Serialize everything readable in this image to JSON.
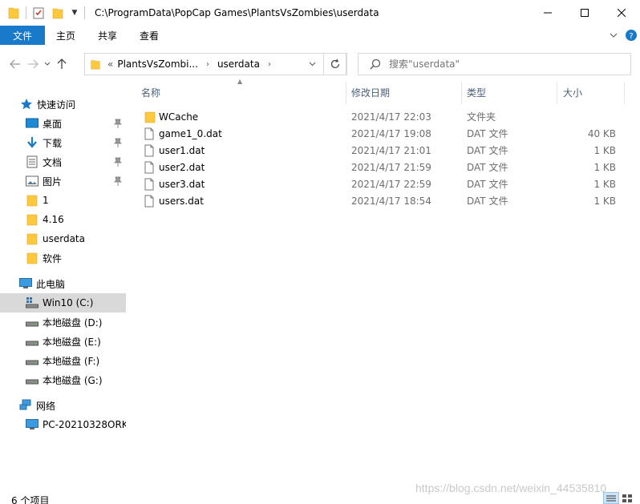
{
  "window": {
    "title_path": "C:\\ProgramData\\PopCap Games\\PlantsVsZombies\\userdata"
  },
  "ribbon": {
    "tabs": [
      "文件",
      "主页",
      "共享",
      "查看"
    ]
  },
  "address": {
    "overflow": "«",
    "crumbs": [
      "PlantsVsZombi...",
      "userdata"
    ]
  },
  "search": {
    "placeholder": "搜索\"userdata\""
  },
  "nav": {
    "quick_access": "快速访问",
    "items": [
      {
        "label": "桌面",
        "icon": "desktop-icon",
        "pinned": true
      },
      {
        "label": "下载",
        "icon": "download-icon",
        "pinned": true
      },
      {
        "label": "文档",
        "icon": "document-icon",
        "pinned": true
      },
      {
        "label": "图片",
        "icon": "picture-icon",
        "pinned": true
      },
      {
        "label": "1",
        "icon": "folder-icon",
        "pinned": false
      },
      {
        "label": "4.16",
        "icon": "folder-icon",
        "pinned": false
      },
      {
        "label": "userdata",
        "icon": "folder-icon",
        "pinned": false
      },
      {
        "label": "软件",
        "icon": "folder-icon",
        "pinned": false
      }
    ],
    "this_pc": "此电脑",
    "drives": [
      {
        "label": "Win10 (C:)",
        "selected": true
      },
      {
        "label": "本地磁盘 (D:)",
        "selected": false
      },
      {
        "label": "本地磁盘 (E:)",
        "selected": false
      },
      {
        "label": "本地磁盘 (F:)",
        "selected": false
      },
      {
        "label": "本地磁盘 (G:)",
        "selected": false
      }
    ],
    "network": "网络",
    "network_pc": "PC-20210328ORK"
  },
  "columns": [
    "名称",
    "修改日期",
    "类型",
    "大小"
  ],
  "files": [
    {
      "name": "WCache",
      "date": "2021/4/17 22:03",
      "type": "文件夹",
      "size": "",
      "kind": "folder"
    },
    {
      "name": "game1_0.dat",
      "date": "2021/4/17 19:08",
      "type": "DAT 文件",
      "size": "40 KB",
      "kind": "file"
    },
    {
      "name": "user1.dat",
      "date": "2021/4/17 21:01",
      "type": "DAT 文件",
      "size": "1 KB",
      "kind": "file"
    },
    {
      "name": "user2.dat",
      "date": "2021/4/17 21:59",
      "type": "DAT 文件",
      "size": "1 KB",
      "kind": "file"
    },
    {
      "name": "user3.dat",
      "date": "2021/4/17 22:59",
      "type": "DAT 文件",
      "size": "1 KB",
      "kind": "file"
    },
    {
      "name": "users.dat",
      "date": "2021/4/17 18:54",
      "type": "DAT 文件",
      "size": "1 KB",
      "kind": "file"
    }
  ],
  "status": {
    "count": "6 个项目"
  },
  "watermark": "https://blog.csdn.net/weixin_44535810",
  "colors": {
    "accent": "#1979ca",
    "folder": "#ffc83d",
    "selected_bg": "#d9d9d9"
  }
}
